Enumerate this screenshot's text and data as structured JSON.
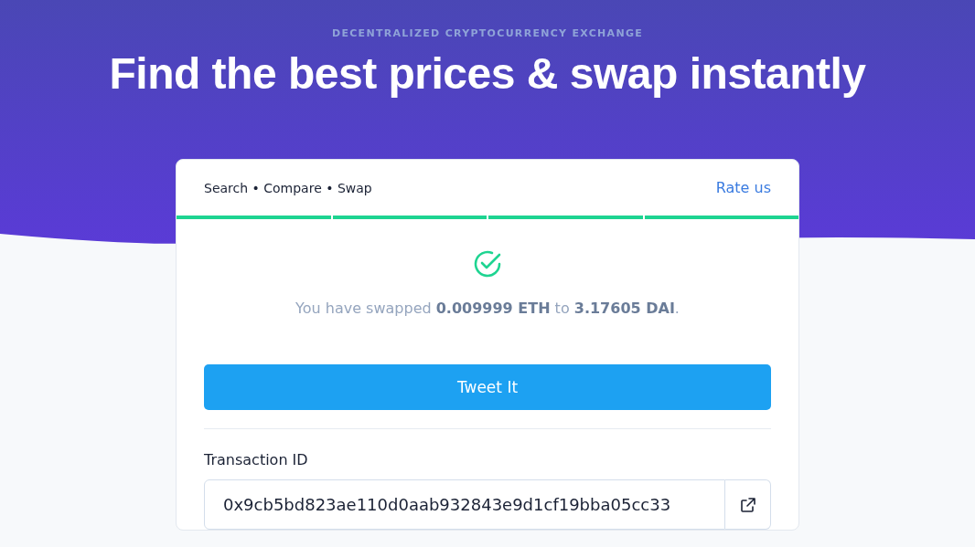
{
  "hero": {
    "eyebrow": "DECENTRALIZED CRYPTOCURRENCY EXCHANGE",
    "title": "Find the best prices & swap instantly"
  },
  "card": {
    "heading": "Search • Compare • Swap",
    "rate_link": "Rate us",
    "steps": [
      {
        "done": true
      },
      {
        "done": true
      },
      {
        "done": true
      },
      {
        "done": true
      }
    ],
    "message": "You have swapped **0.009999 ETH** to **3.17605 DAI**.",
    "tweet_button": "Tweet It",
    "transaction": {
      "label": "Transaction ID",
      "value": "0x9cb5bd823ae110d0aab932843e9d1cf19bba05cc33"
    }
  }
}
